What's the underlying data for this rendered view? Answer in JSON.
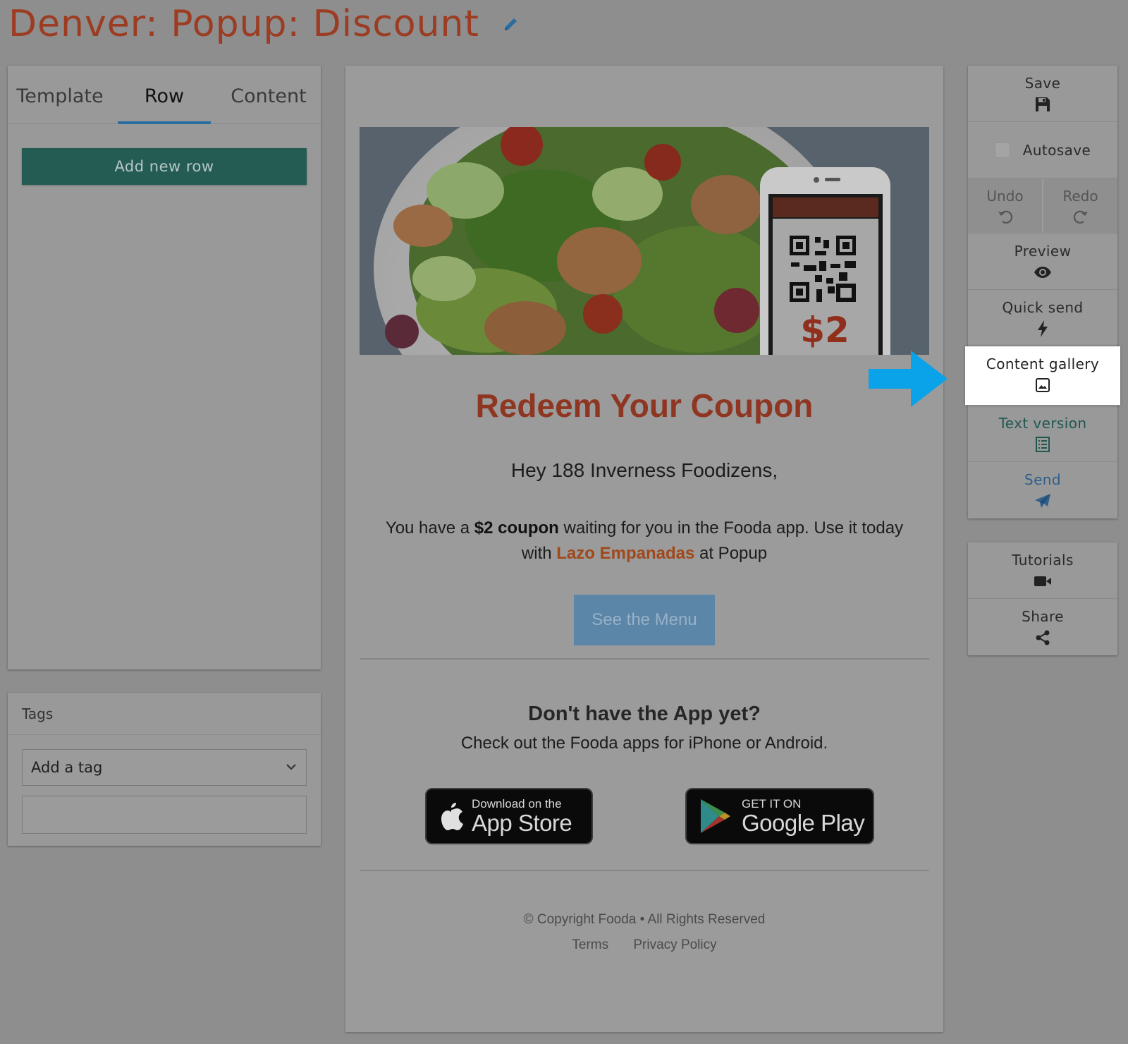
{
  "page": {
    "title": "Denver: Popup: Discount"
  },
  "left_panel": {
    "tabs": [
      {
        "label": "Template",
        "active": false
      },
      {
        "label": "Row",
        "active": true
      },
      {
        "label": "Content",
        "active": false
      }
    ],
    "add_row_label": "Add new row"
  },
  "tags_panel": {
    "header": "Tags",
    "select_value": "Add a tag"
  },
  "email": {
    "hero_coupon_amount": "$2",
    "coupon_title": "Redeem Your Coupon",
    "greeting": "Hey 188 Inverness Foodizens,",
    "body_prefix": "You have a ",
    "body_bold": "$2 coupon",
    "body_middle": " waiting for you in the Fooda app. Use it today with ",
    "body_vendor": "Lazo Empanadas",
    "body_suffix": " at Popup",
    "menu_button": "See the Menu",
    "no_app_heading": "Don't have the App yet?",
    "no_app_text": "Check out the Fooda apps for iPhone or Android.",
    "appstore_small": "Download on the",
    "appstore_big": "App Store",
    "googleplay_small": "GET IT ON",
    "googleplay_big": "Google Play",
    "copyright": "© Copyright Fooda • All Rights Reserved",
    "terms": "Terms",
    "privacy": "Privacy Policy"
  },
  "toolbar": {
    "save": "Save",
    "autosave": "Autosave",
    "undo": "Undo",
    "redo": "Redo",
    "preview": "Preview",
    "quick_send": "Quick send",
    "content_gallery": "Content gallery",
    "text_version": "Text version",
    "send": "Send",
    "tutorials": "Tutorials",
    "share": "Share"
  },
  "colors": {
    "title": "#9c3c22",
    "highlight": "#ffffff",
    "arrow": "#0aa2e8"
  }
}
